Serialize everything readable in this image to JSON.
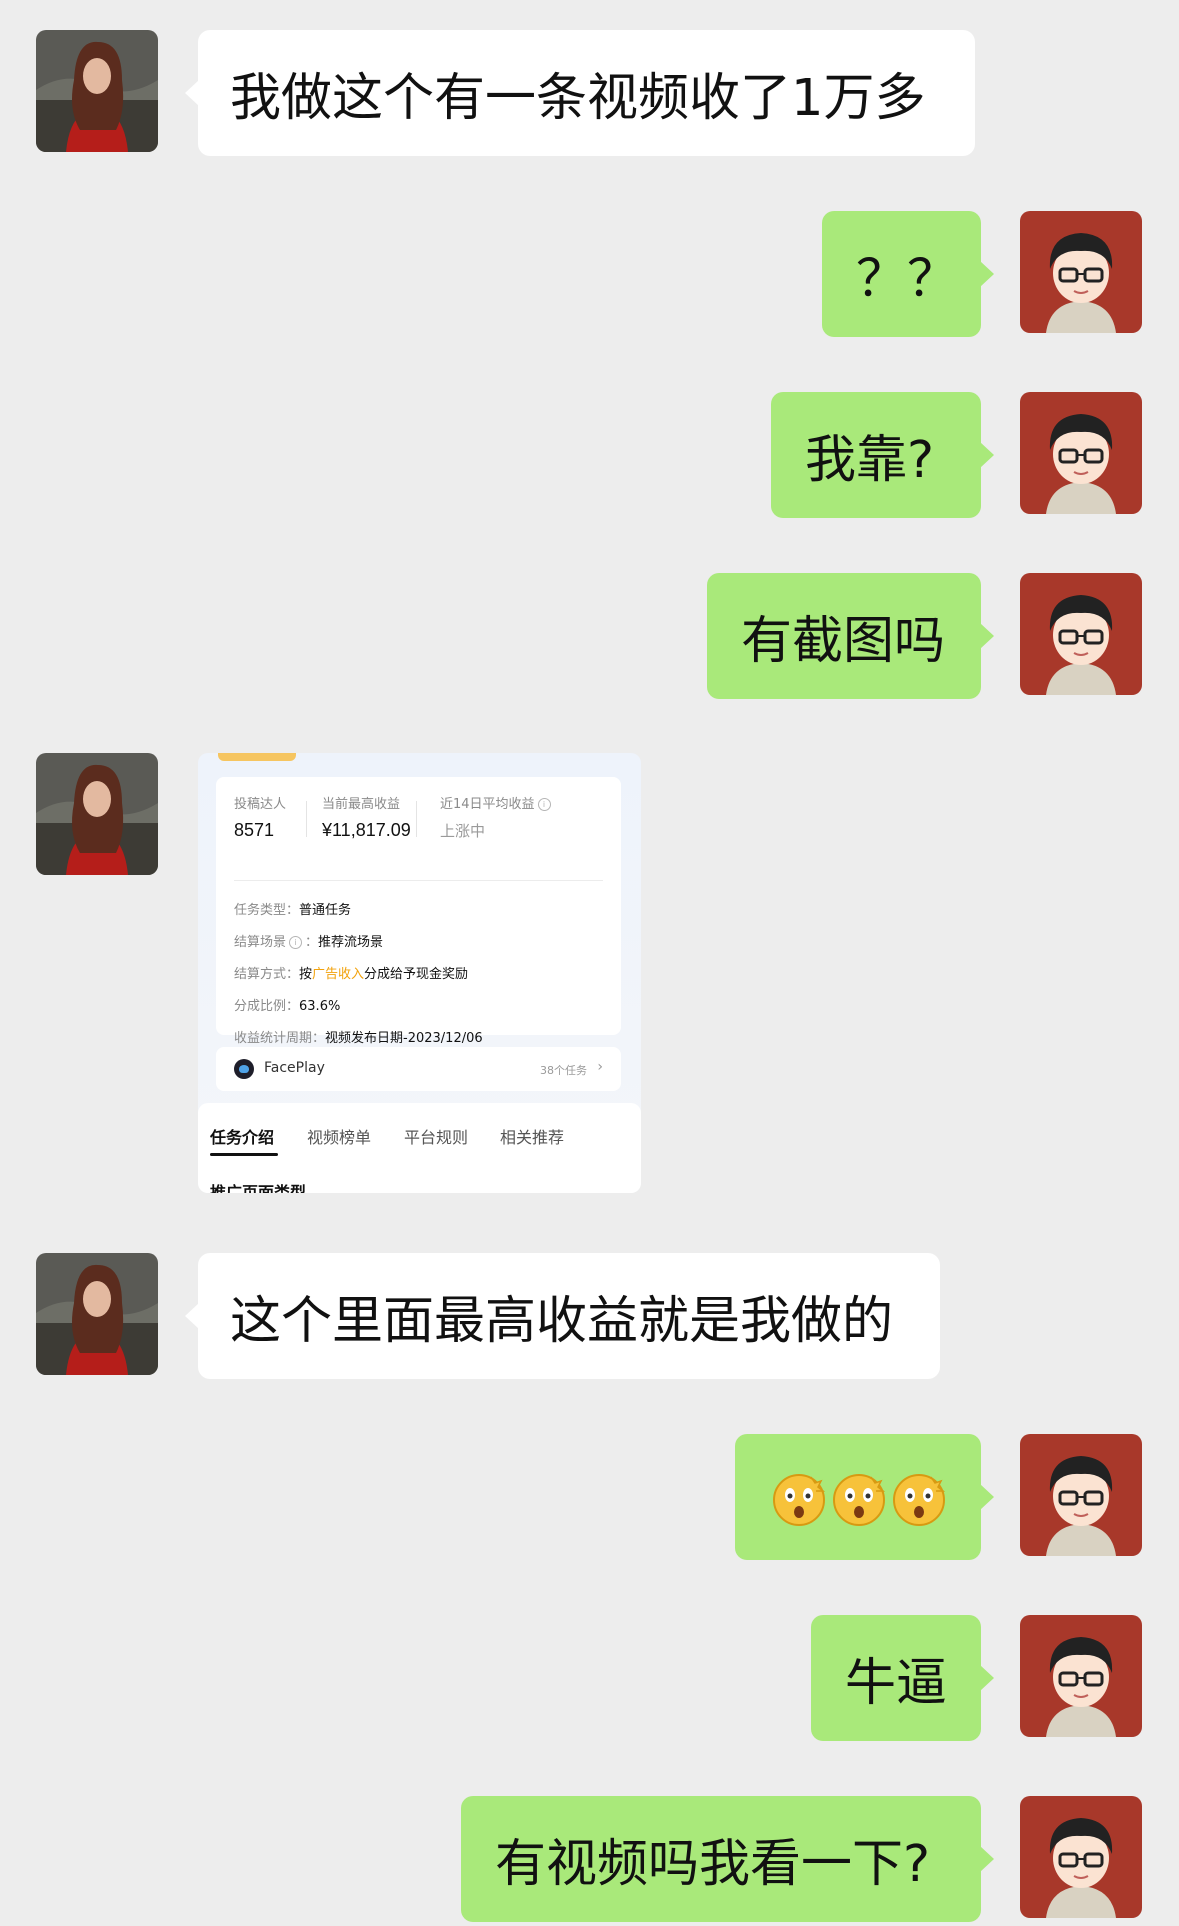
{
  "messages": [
    {
      "side": "in",
      "text": "我做这个有一条视频收了1万多"
    },
    {
      "side": "out",
      "text": "？？"
    },
    {
      "side": "out",
      "text": "我靠?"
    },
    {
      "side": "out",
      "text": "有截图吗"
    },
    {
      "side": "in",
      "type": "image"
    },
    {
      "side": "in",
      "text": "这个里面最高收益就是我做的"
    },
    {
      "side": "out",
      "type": "emoji",
      "emoji": "astonished-face-emoji x3"
    },
    {
      "side": "out",
      "text": "牛逼"
    },
    {
      "side": "out",
      "text": "有视频吗我看一下?"
    }
  ],
  "screenshot": {
    "stats": [
      {
        "label": "投稿达人",
        "value": "8571"
      },
      {
        "label": "当前最高收益",
        "value": "¥11,817.09"
      },
      {
        "label": "近14日平均收益",
        "value": "上涨中"
      }
    ],
    "rows": {
      "type_label": "任务类型：",
      "type_value": "普通任务",
      "scene_label": "结算场景",
      "scene_value": "推荐流场景",
      "method_label": "结算方式：",
      "method_pre": "按",
      "method_hl": "广告收入",
      "method_post": "分成给予现金奖励",
      "ratio_label": "分成比例：",
      "ratio_value": "63.6%",
      "period_label": "收益统计周期：",
      "period_value": "视频发布日期-2023/12/06"
    },
    "facePlay": {
      "name": "FacePlay",
      "count": "38个任务"
    },
    "tabs": [
      "任务介绍",
      "视频榜单",
      "平台规则",
      "相关推荐"
    ],
    "cut_text": "推广页面类型"
  },
  "colors": {
    "outgoing": "#a9e97a",
    "incoming": "#ffffff",
    "background": "#ededed",
    "highlight": "#f2a20c"
  }
}
